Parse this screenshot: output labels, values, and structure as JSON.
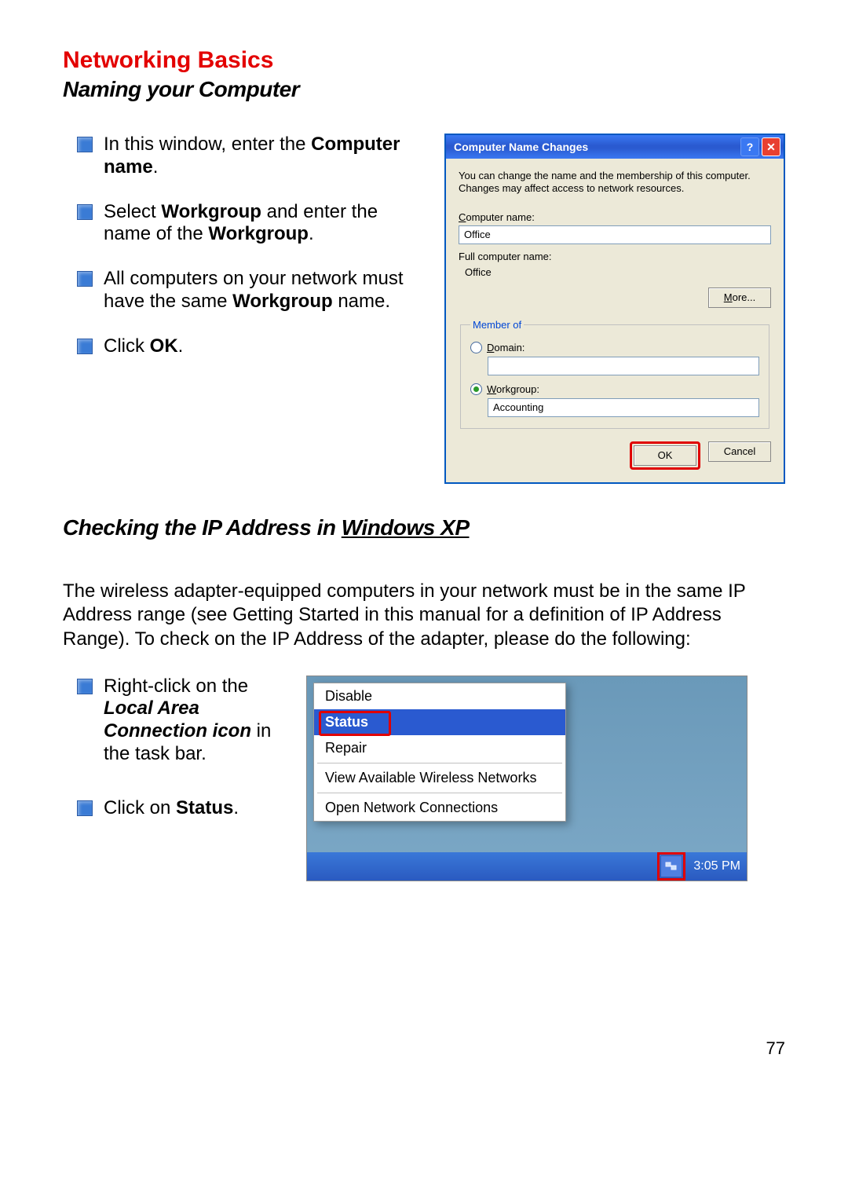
{
  "header": {
    "title": "Networking Basics",
    "subtitle": "Naming your Computer"
  },
  "steps_a": {
    "items": [
      {
        "pre": "In this window, enter the ",
        "bold": "Computer name",
        "post": "."
      },
      {
        "pre": "Select ",
        "bold": "Workgroup",
        "post": " and enter the name of the ",
        "bold2": "Workgroup",
        "post2": "."
      },
      {
        "pre": "All computers on your network must have the same ",
        "bold": "Workgroup",
        "post": " name."
      },
      {
        "pre": "Click ",
        "bold": "OK",
        "post": "."
      }
    ]
  },
  "dialog": {
    "title": "Computer Name Changes",
    "desc": "You can change the name and the membership of this computer. Changes may affect access to network resources.",
    "comp_label": "Computer name:",
    "comp_value": "Office",
    "full_label": "Full computer name:",
    "full_value": "Office",
    "more": "More...",
    "member_legend": "Member of",
    "domain_label": "Domain:",
    "domain_value": "",
    "workgroup_label": "Workgroup:",
    "workgroup_value": "Accounting",
    "ok": "OK",
    "cancel": "Cancel"
  },
  "section2": {
    "heading_pre": "Checking the IP Address in ",
    "heading_underline": "Windows XP",
    "para": "The wireless adapter-equipped computers in your network must be in the same IP Address range (see Getting Started in this manual for a definition of IP Address Range). To check on the IP Address of the adapter, please do the following:"
  },
  "steps_b": {
    "items": [
      {
        "pre": "Right-click on the ",
        "italbold": "Local Area Connection icon",
        "post": " in the task bar."
      },
      {
        "pre": "Click on ",
        "bold": "Status",
        "post": "."
      }
    ]
  },
  "ctx": {
    "disable": "Disable",
    "status": "Status",
    "repair": "Repair",
    "view": "View Available Wireless Networks",
    "open": "Open Network Connections",
    "time": "3:05 PM"
  },
  "page_number": "77"
}
